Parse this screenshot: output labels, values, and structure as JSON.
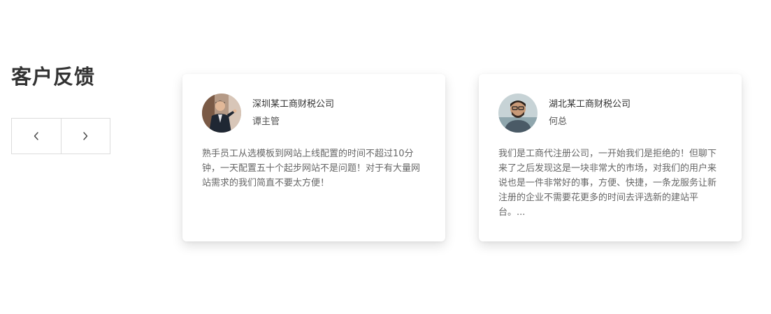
{
  "section": {
    "title": "客户反馈"
  },
  "nav": {
    "prev_icon": "chevron-left-icon",
    "next_icon": "chevron-right-icon"
  },
  "testimonials": [
    {
      "company": "深圳某工商财税公司",
      "person": "谭主管",
      "quote": "熟手员工从选模板到网站上线配置的时间不超过10分钟，一天配置五十个起步网站不是问题！对于有大量网站需求的我们简直不要太方便！"
    },
    {
      "company": "湖北某工商财税公司",
      "person": "何总",
      "quote": "我们是工商代注册公司，一开始我们是拒绝的！但聊下来了之后发现这是一块非常大的市场，对我们的用户来说也是一件非常好的事，方便、快捷，一条龙服务让新注册的企业不需要花更多的时间去评选新的建站平台。..."
    }
  ],
  "colors": {
    "title": "#333333",
    "border": "#dcdcdc",
    "text_muted": "#666666"
  }
}
